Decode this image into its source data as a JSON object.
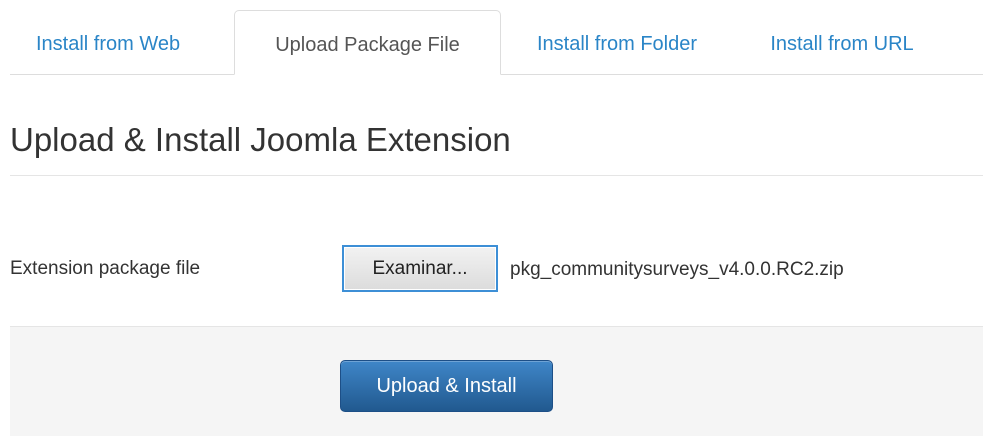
{
  "tabs": [
    {
      "label": "Install from Web",
      "active": false
    },
    {
      "label": "Upload Package File",
      "active": true
    },
    {
      "label": "Install from Folder",
      "active": false
    },
    {
      "label": "Install from URL",
      "active": false
    }
  ],
  "page": {
    "title": "Upload & Install Joomla Extension"
  },
  "form": {
    "package_label": "Extension package file",
    "browse_button": "Examinar...",
    "selected_file": "pkg_communitysurveys_v4.0.0.RC2.zip",
    "submit_button": "Upload & Install"
  },
  "colors": {
    "link": "#2a85c7",
    "active_tab_text": "#555555",
    "primary_button": "#2f70b0",
    "focus_border": "#3d8fd6",
    "actions_background": "#f5f5f5"
  }
}
